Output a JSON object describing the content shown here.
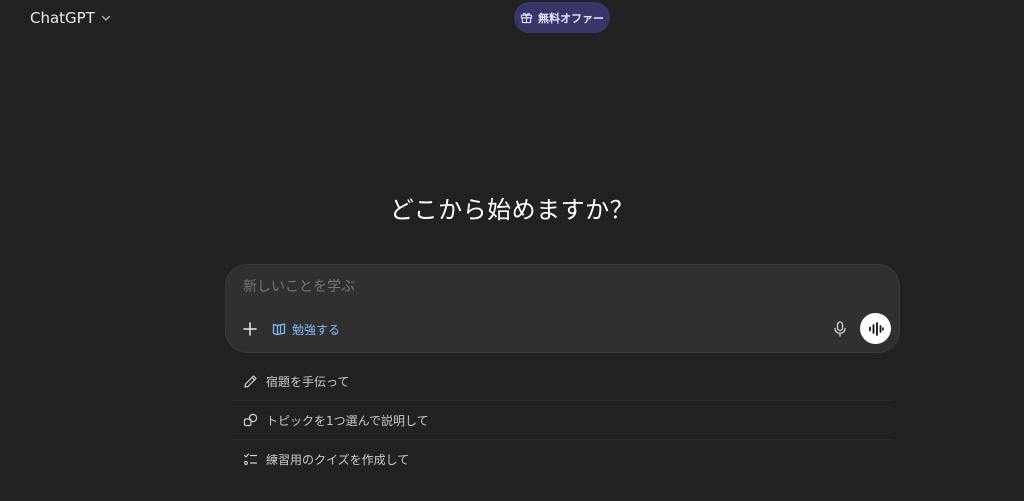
{
  "header": {
    "model_label": "ChatGPT",
    "offer_label": "無料オファー"
  },
  "main": {
    "headline": "どこから始めますか？"
  },
  "composer": {
    "placeholder": "新しいことを学ぶ",
    "study_label": "勉強する"
  },
  "suggestions": [
    {
      "label": "宿題を手伝って",
      "icon": "pencil-icon"
    },
    {
      "label": "トピックを1つ選んで説明して",
      "icon": "shapes-icon"
    },
    {
      "label": "練習用のクイズを作成して",
      "icon": "checklist-icon"
    }
  ],
  "colors": {
    "background": "#212121",
    "composer": "#303030",
    "offer_bg": "#373669",
    "study_accent": "#84b8ff"
  }
}
